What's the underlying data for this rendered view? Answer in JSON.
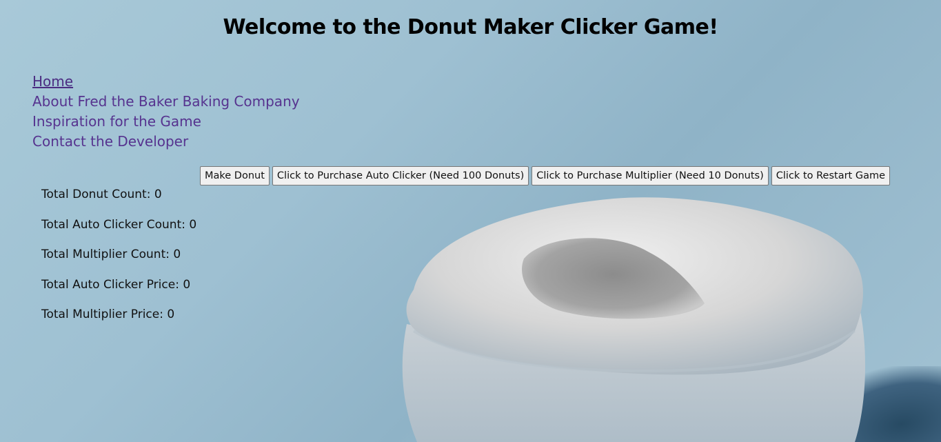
{
  "header": {
    "title": "Welcome to the Donut Maker Clicker Game!"
  },
  "nav": {
    "items": [
      {
        "label": "Home"
      },
      {
        "label": "About Fred the Baker Baking Company"
      },
      {
        "label": "Inspiration for the Game"
      },
      {
        "label": "Contact the Developer"
      }
    ]
  },
  "controls": {
    "make_donut": "Make Donut",
    "purchase_auto_clicker": "Click to Purchase Auto Clicker (Need 100 Donuts)",
    "purchase_multiplier": "Click to Purchase Multiplier (Need 10 Donuts)",
    "restart": "Click to Restart Game"
  },
  "stats": {
    "donut_count": "Total Donut Count: 0",
    "auto_clicker_count": "Total Auto Clicker Count: 0",
    "multiplier_count": "Total Multiplier Count: 0",
    "auto_clicker_price": "Total Auto Clicker Price: 0",
    "multiplier_price": "Total Multiplier Price: 0"
  },
  "colors": {
    "background": "#9ec0d2",
    "link": "#56338f",
    "donut": "#d9d9d9"
  }
}
